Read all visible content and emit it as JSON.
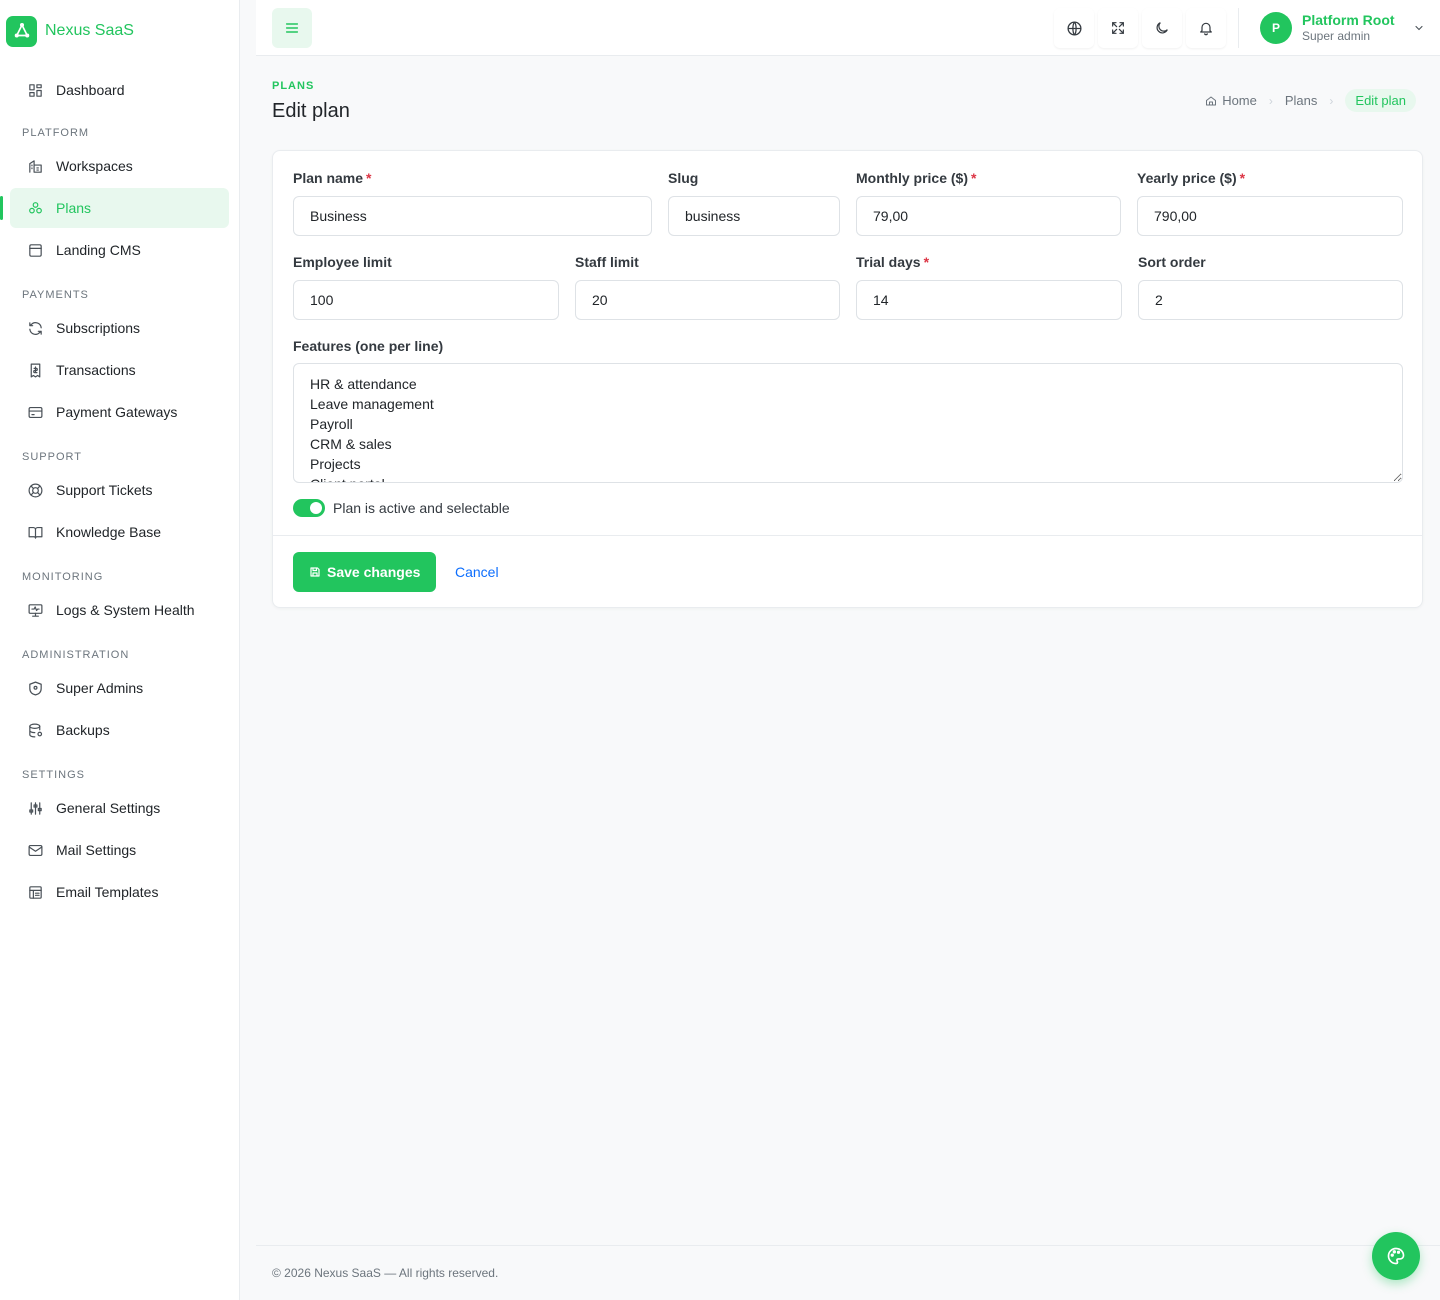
{
  "brand": {
    "name": "Nexus SaaS"
  },
  "sidebar": {
    "sections": [
      {
        "title": "",
        "items": [
          {
            "label": "Dashboard",
            "icon": "dashboard-icon"
          }
        ]
      },
      {
        "title": "PLATFORM",
        "items": [
          {
            "label": "Workspaces",
            "icon": "building-icon"
          },
          {
            "label": "Plans",
            "icon": "plans-icon",
            "active": true
          },
          {
            "label": "Landing CMS",
            "icon": "browser-icon"
          }
        ]
      },
      {
        "title": "PAYMENTS",
        "items": [
          {
            "label": "Subscriptions",
            "icon": "refresh-icon"
          },
          {
            "label": "Transactions",
            "icon": "receipt-icon"
          },
          {
            "label": "Payment Gateways",
            "icon": "card-icon"
          }
        ]
      },
      {
        "title": "SUPPORT",
        "items": [
          {
            "label": "Support Tickets",
            "icon": "lifebuoy-icon"
          },
          {
            "label": "Knowledge Base",
            "icon": "book-icon"
          }
        ]
      },
      {
        "title": "MONITORING",
        "items": [
          {
            "label": "Logs & System Health",
            "icon": "monitor-icon"
          }
        ]
      },
      {
        "title": "ADMINISTRATION",
        "items": [
          {
            "label": "Super Admins",
            "icon": "shield-icon"
          },
          {
            "label": "Backups",
            "icon": "database-icon"
          }
        ]
      },
      {
        "title": "SETTINGS",
        "items": [
          {
            "label": "General Settings",
            "icon": "sliders-icon"
          },
          {
            "label": "Mail Settings",
            "icon": "mail-icon"
          },
          {
            "label": "Email Templates",
            "icon": "template-icon"
          }
        ]
      }
    ]
  },
  "topbar": {
    "user": {
      "initial": "P",
      "name": "Platform Root",
      "role": "Super admin"
    }
  },
  "page": {
    "pretitle": "PLANS",
    "title": "Edit plan",
    "breadcrumb": {
      "home": "Home",
      "plans": "Plans",
      "current": "Edit plan"
    }
  },
  "form": {
    "plan_name": {
      "label": "Plan name",
      "value": "Business"
    },
    "slug": {
      "label": "Slug",
      "value": "business"
    },
    "monthly_price": {
      "label": "Monthly price ($)",
      "value": "79,00"
    },
    "yearly_price": {
      "label": "Yearly price ($)",
      "value": "790,00"
    },
    "employee_limit": {
      "label": "Employee limit",
      "value": "100"
    },
    "staff_limit": {
      "label": "Staff limit",
      "value": "20"
    },
    "trial_days": {
      "label": "Trial days",
      "value": "14"
    },
    "sort_order": {
      "label": "Sort order",
      "value": "2"
    },
    "features": {
      "label": "Features (one per line)",
      "value": "HR & attendance\nLeave management\nPayroll\nCRM & sales\nProjects\nClient portal"
    },
    "active_toggle": {
      "label": "Plan is active and selectable",
      "checked": true
    },
    "save_label": "Save changes",
    "cancel_label": "Cancel"
  },
  "footer": {
    "text": "© 2026 Nexus SaaS — All rights reserved."
  },
  "colors": {
    "accent": "#22c55e",
    "accent_soft": "#e8f8ee",
    "link": "#0d6efd",
    "required": "#dc3545"
  }
}
